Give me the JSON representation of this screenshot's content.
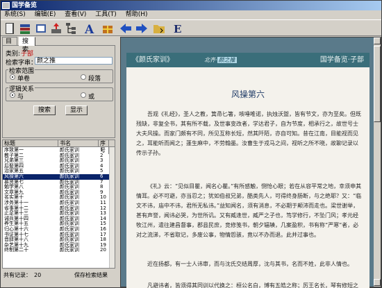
{
  "window": {
    "title": "国学备览"
  },
  "menu": [
    "系统(S)",
    "编辑(E)",
    "查看(V)",
    "工具(T)",
    "帮助(H)"
  ],
  "toolbar_icons": [
    "book-icon",
    "book-stack-icon",
    "document-icon",
    "download-icon",
    "tree-icon",
    "font-icon",
    "gift-icon",
    "back-arrow-icon",
    "forward-arrow-icon",
    "folder-icon",
    "e-icon"
  ],
  "tabs": {
    "catalog": "目录",
    "search": "搜索"
  },
  "search": {
    "category_label": "类别:",
    "category_value": "子部",
    "keyword_label": "检索字串：",
    "keyword_value": "颜之推",
    "scope_label": "检索范围",
    "scope_opt1": "单卷",
    "scope_opt2": "段落",
    "logic_label": "逻辑关系",
    "logic_opt1": "与",
    "logic_opt2": "或",
    "search_button": "搜索",
    "show_button": "显示"
  },
  "results": {
    "headers": {
      "title": "标题",
      "book": "书名",
      "num": "序号"
    },
    "rows": [
      {
        "title": "序致第一",
        "book": "颜氏家训",
        "num": "1"
      },
      {
        "title": "教子第二",
        "book": "颜氏家训",
        "num": "2"
      },
      {
        "title": "兄弟第三",
        "book": "颜氏家训",
        "num": "3"
      },
      {
        "title": "后娶第四",
        "book": "颜氏家训",
        "num": "4"
      },
      {
        "title": "治家第五",
        "book": "颜氏家训",
        "num": "5"
      },
      {
        "title": "风操第六",
        "book": "颜氏家训",
        "num": "6"
      },
      {
        "title": "慕贤第七",
        "book": "颜氏家训",
        "num": "7"
      },
      {
        "title": "勉学第八",
        "book": "颜氏家训",
        "num": "8"
      },
      {
        "title": "文章第九",
        "book": "颜氏家训",
        "num": "9"
      },
      {
        "title": "名实第十",
        "book": "颜氏家训",
        "num": "10"
      },
      {
        "title": "涉务第十一",
        "book": "颜氏家训",
        "num": "11"
      },
      {
        "title": "省事第十二",
        "book": "颜氏家训",
        "num": "12"
      },
      {
        "title": "止足第十三",
        "book": "颜氏家训",
        "num": "13"
      },
      {
        "title": "诫兵第十四",
        "book": "颜氏家训",
        "num": "14"
      },
      {
        "title": "养生第十五",
        "book": "颜氏家训",
        "num": "15"
      },
      {
        "title": "归心第十六",
        "book": "颜氏家训",
        "num": "16"
      },
      {
        "title": "书证第十七",
        "book": "颜氏家训",
        "num": "17"
      },
      {
        "title": "音辞第十八",
        "book": "颜氏家训",
        "num": "18"
      },
      {
        "title": "杂艺第十九",
        "book": "颜氏家训",
        "num": "19"
      },
      {
        "title": "终制第二十",
        "book": "颜氏家训",
        "num": "20"
      }
    ],
    "selected_index": 5
  },
  "status": {
    "count_label": "共有记录：",
    "count": "20",
    "save": "保存检索结果"
  },
  "reader": {
    "book": "《颜氏家训》",
    "author_prefix": "北齐·",
    "author_name": "颜之推",
    "site": "国学备览·子部",
    "chapter": "风操第六",
    "paragraphs": [
      "吾观《礼经》，圣人之教，箕帚匕箸，咳唾唯诺，执烛沃盥，皆有节文，亦为至矣。但既残缺，非复全书，其有所不载，及世事变改者，学达君子，自为节度，相承行之，故世号士大夫风操。而家门颇有不同，所见互称长短，然其阡陌，亦自可知。昔在江南，目能视而见之，耳能听而闻之；蓬生麻中，不劳翰墨。汝曹生于戎马之间，视听之所不晓，故聊记录以传示子孙。",
      "《礼》云：“见似目瞿，闻名心瞿。”有所感触，恻怆心眼；若在从容平常之地，幸须申其情耳。必不可避，亦当忍之；犹如伯叔兄弟，酷类先人，可得终身肠断，与之绝耶？又：“临文不讳，庙中不讳，君所无私讳。”益知闻名，须有消息，不必期于颠沛而走也。梁世谢举，甚有声誉，闻讳必哭，为世所讥。又有臧逢世，臧严之子也，笃学修行，不坠门风；孝元经牧江州，遣往建昌督事，郡县民庶，竞修笺书，朝夕辐辏，几案盈积，书有称“严寒”者，必对之流涕，不省取记，多废公事，物情怨骇，竟以不办而退。此并过事也。",
      "近在扬都，有一士人讳审，而与沈氏交结周厚，沈与其书，名而不姓，此非人情也。",
      "凡避讳者，皆须得其同训以代换之：桓公名白，博有五皓之称；厉王名长，琴有修短之目。不闻谓布帛为布皓，呼肾肠为肾修也。梁武小名阿练，子孙皆呼练为绢；"
    ]
  },
  "colors": {
    "titlebar": "#0a246a",
    "reader_header": "#3a6e7a",
    "chapter_title": "#1e3a66",
    "category": "#c00000",
    "selection": "#0a246a"
  }
}
